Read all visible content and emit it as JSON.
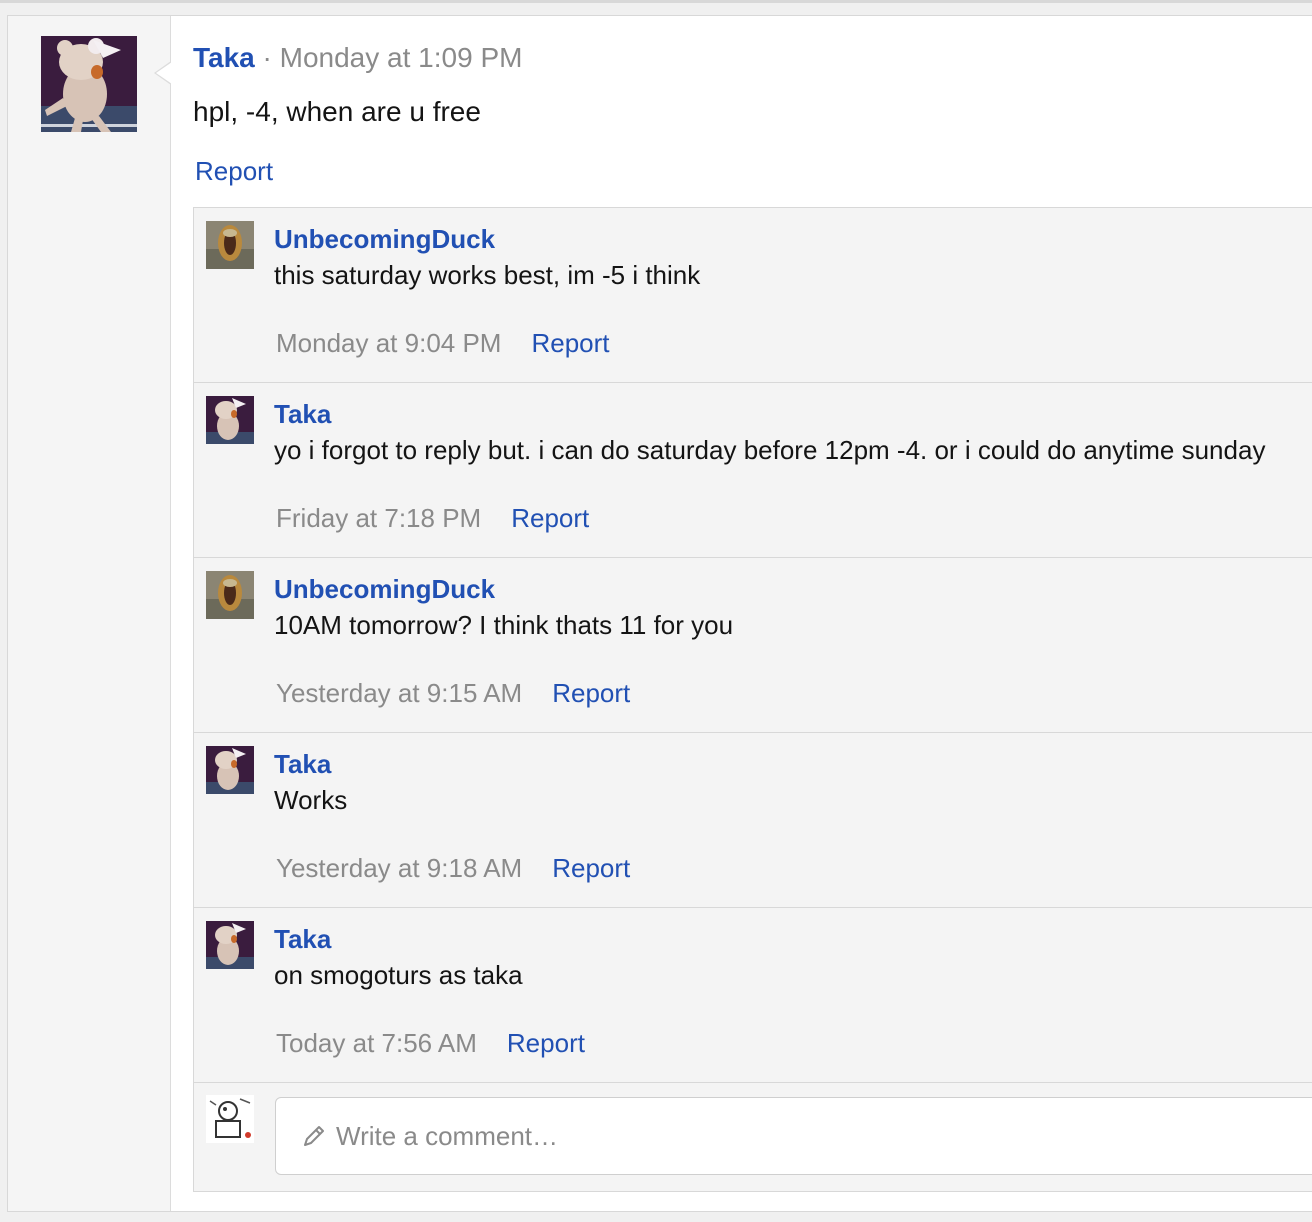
{
  "post": {
    "author": "Taka",
    "separator": " · ",
    "timestamp": "Monday at 1:09 PM",
    "body": "hpl, -4, when are u free",
    "report_label": "Report"
  },
  "comments": [
    {
      "author": "UnbecomingDuck",
      "text": "this saturday works best, im -5 i think",
      "time": "Monday at 9:04 PM",
      "report": "Report",
      "avatar": "duck"
    },
    {
      "author": "Taka",
      "text": "yo i forgot to reply but. i can do saturday before 12pm -4. or i could do anytime sunday",
      "time": "Friday at 7:18 PM",
      "report": "Report",
      "avatar": "taka"
    },
    {
      "author": "UnbecomingDuck",
      "text": "10AM tomorrow? I think thats 11 for you",
      "time": "Yesterday at 9:15 AM",
      "report": "Report",
      "avatar": "duck"
    },
    {
      "author": "Taka",
      "text": "Works",
      "time": "Yesterday at 9:18 AM",
      "report": "Report",
      "avatar": "taka"
    },
    {
      "author": "Taka",
      "text": "on smogoturs as taka",
      "time": "Today at 7:56 AM",
      "report": "Report",
      "avatar": "taka"
    }
  ],
  "composer": {
    "placeholder": "Write a comment…",
    "icon": "pencil-icon"
  },
  "colors": {
    "link": "#2150b3",
    "muted": "#8a8a8a",
    "panel": "#f4f4f4"
  }
}
